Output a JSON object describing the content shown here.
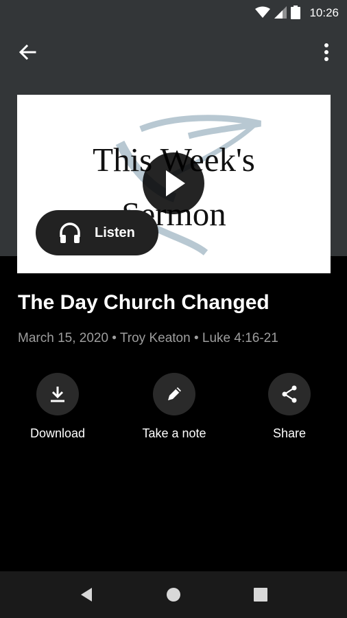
{
  "status": {
    "time": "10:26"
  },
  "artwork": {
    "line1": "This Week's",
    "line2": "Sermon"
  },
  "player": {
    "listen_label": "Listen"
  },
  "sermon": {
    "title": "The Day Church Changed",
    "meta": "March 15, 2020 • Troy Keaton • Luke 4:16-21"
  },
  "actions": [
    {
      "label": "Download",
      "icon": "download-icon"
    },
    {
      "label": "Take a note",
      "icon": "pencil-icon"
    },
    {
      "label": "Share",
      "icon": "share-icon"
    }
  ],
  "colors": {
    "header_bg": "#333638",
    "body_bg": "#000000",
    "meta_text": "#9e9e9e"
  }
}
